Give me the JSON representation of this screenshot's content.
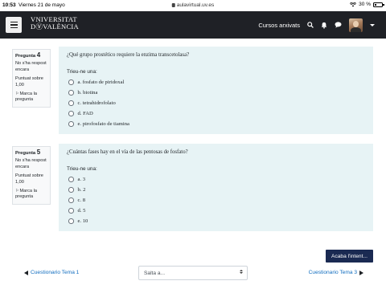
{
  "status_bar": {
    "time": "10:53",
    "date": "Viernes 21 de mayo",
    "url": "aulavirtual.uv.es",
    "battery_text": "30 %",
    "battery_level": 0.3
  },
  "navbar": {
    "brand_line1": "VNIVERSITAT",
    "brand_line2": "DⓋVALÈNCIA",
    "courses_label": "Cursos arxivats",
    "icons": [
      "menu-icon",
      "search-icon",
      "bell-icon",
      "chat-icon",
      "avatar",
      "caret-down-icon"
    ]
  },
  "questions": [
    {
      "label": "Pregunta",
      "number": "4",
      "state": "No s'ha respost encara",
      "grade": "Puntuat sobre 1,00",
      "flag": "Marca la pregunta",
      "text": "¿Qué grupo prostético requiere la enzima transcetolasa?",
      "prompt": "Trieu-ne una:",
      "answers": [
        "a. fosfato de piridoxal",
        "b. biotina",
        "c. tetrahidrofolato",
        "d. FAD",
        "e. pirofosfato de tiamina"
      ]
    },
    {
      "label": "Pregunta",
      "number": "5",
      "state": "No s'ha respost encara",
      "grade": "Puntuat sobre 1,00",
      "flag": "Marca la pregunta",
      "text": "¿Cuántas fases hay en el vía de las pentosas de fosfato?",
      "prompt": "Trieu-ne una:",
      "answers": [
        "a. 3",
        "b. 2",
        "c. 8",
        "d. 5",
        "e. 10"
      ]
    }
  ],
  "footer": {
    "finish_label": "Acaba l'intent...",
    "prev_label": "Cuestionario Tema 1",
    "jump_placeholder": "Salta a...",
    "next_label": "Cuestionario Tema 3"
  }
}
